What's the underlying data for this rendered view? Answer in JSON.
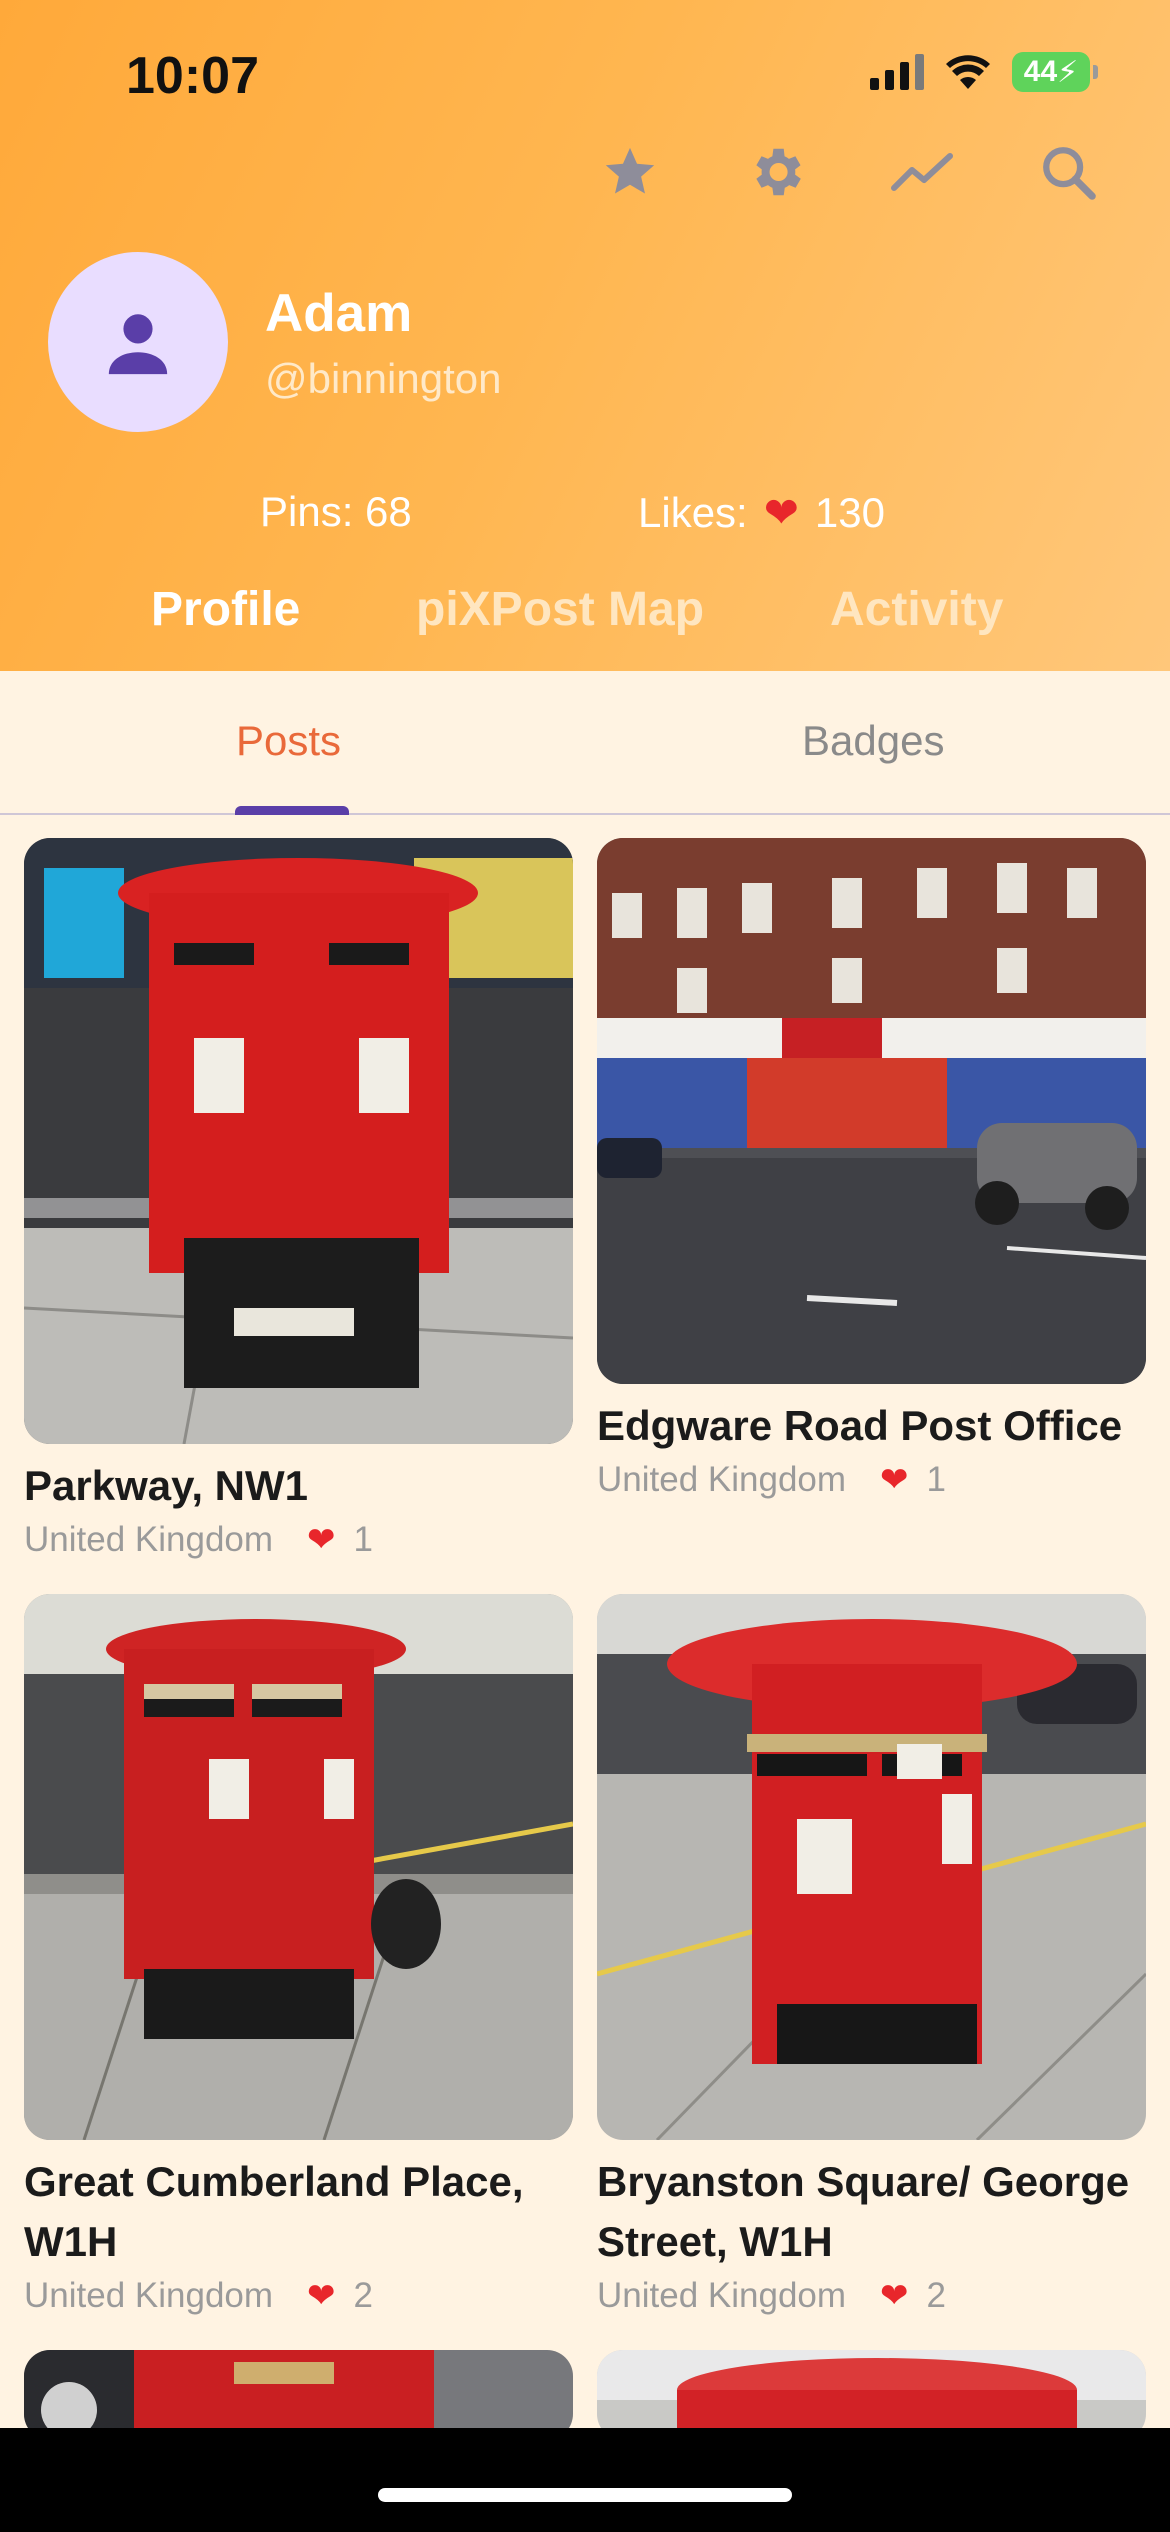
{
  "status": {
    "time": "10:07",
    "battery": "44"
  },
  "header": {
    "icons": [
      "star-icon",
      "gear-icon",
      "trending-icon",
      "search-icon"
    ],
    "avatar_icon": "person-icon",
    "name": "Adam",
    "handle": "@binnington",
    "pins_label": "Pins: 68",
    "likes_label": "Likes:",
    "likes_count": "130",
    "tabs": [
      {
        "label": "Profile",
        "active": true
      },
      {
        "label": "piXPost Map",
        "active": false
      },
      {
        "label": "Activity",
        "active": false
      }
    ]
  },
  "subtabs": [
    {
      "label": "Posts",
      "active": true
    },
    {
      "label": "Badges",
      "active": false
    }
  ],
  "posts": [
    {
      "title": "Parkway, NW1",
      "country": "United Kingdom",
      "likes": "1"
    },
    {
      "title": "Edgware Road Post Office",
      "country": "United Kingdom",
      "likes": "1"
    },
    {
      "title": "Great Cumberland Place, W1H",
      "country": "United Kingdom",
      "likes": "2"
    },
    {
      "title": "Bryanston Square/ George Street, W1H",
      "country": "United Kingdom",
      "likes": "2"
    }
  ],
  "colors": {
    "accent": "#e9693a",
    "heart": "#e8262b",
    "indicator": "#5a3ea8",
    "header": "#ffb24a"
  }
}
